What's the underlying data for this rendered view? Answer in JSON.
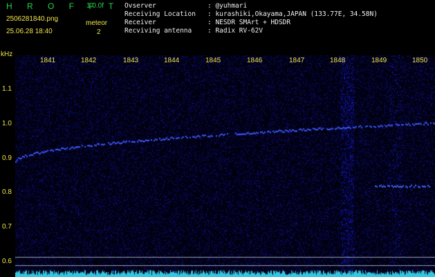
{
  "header": {
    "brand": "H R O F F T",
    "version": "1.0.0f",
    "filename": "2506281840.png",
    "timestamp": "25.06.28 18:40",
    "meteor_label": "meteor",
    "meteor_count": "2"
  },
  "metadata": [
    {
      "key": "Ovserver",
      "value": ": @yuhmari"
    },
    {
      "key": "Receiving Location",
      "value": ": kurashiki,Okayama,JAPAN (133.77E, 34.58N)"
    },
    {
      "key": "Receiver",
      "value": ": NESDR SMArt + HDSDR"
    },
    {
      "key": "Recviving antenna",
      "value": ": Radix RV-62V"
    }
  ],
  "y_axis": {
    "unit": "kHz",
    "ticks": [
      "1.1",
      "1.0",
      "0.9",
      "0.8",
      "0.7",
      "0.6"
    ]
  },
  "x_axis": {
    "ticks": [
      "1841",
      "1842",
      "1843",
      "1844",
      "1845",
      "1846",
      "1847",
      "1848",
      "1849",
      "1850"
    ]
  },
  "colors": {
    "brand": "#22d64a",
    "label": "#f2e64a",
    "text": "#f2f2f2",
    "background": "#000000",
    "noise": "#1a1a8c",
    "signal": "#3050ff",
    "baseline": "#35c7e0"
  }
}
